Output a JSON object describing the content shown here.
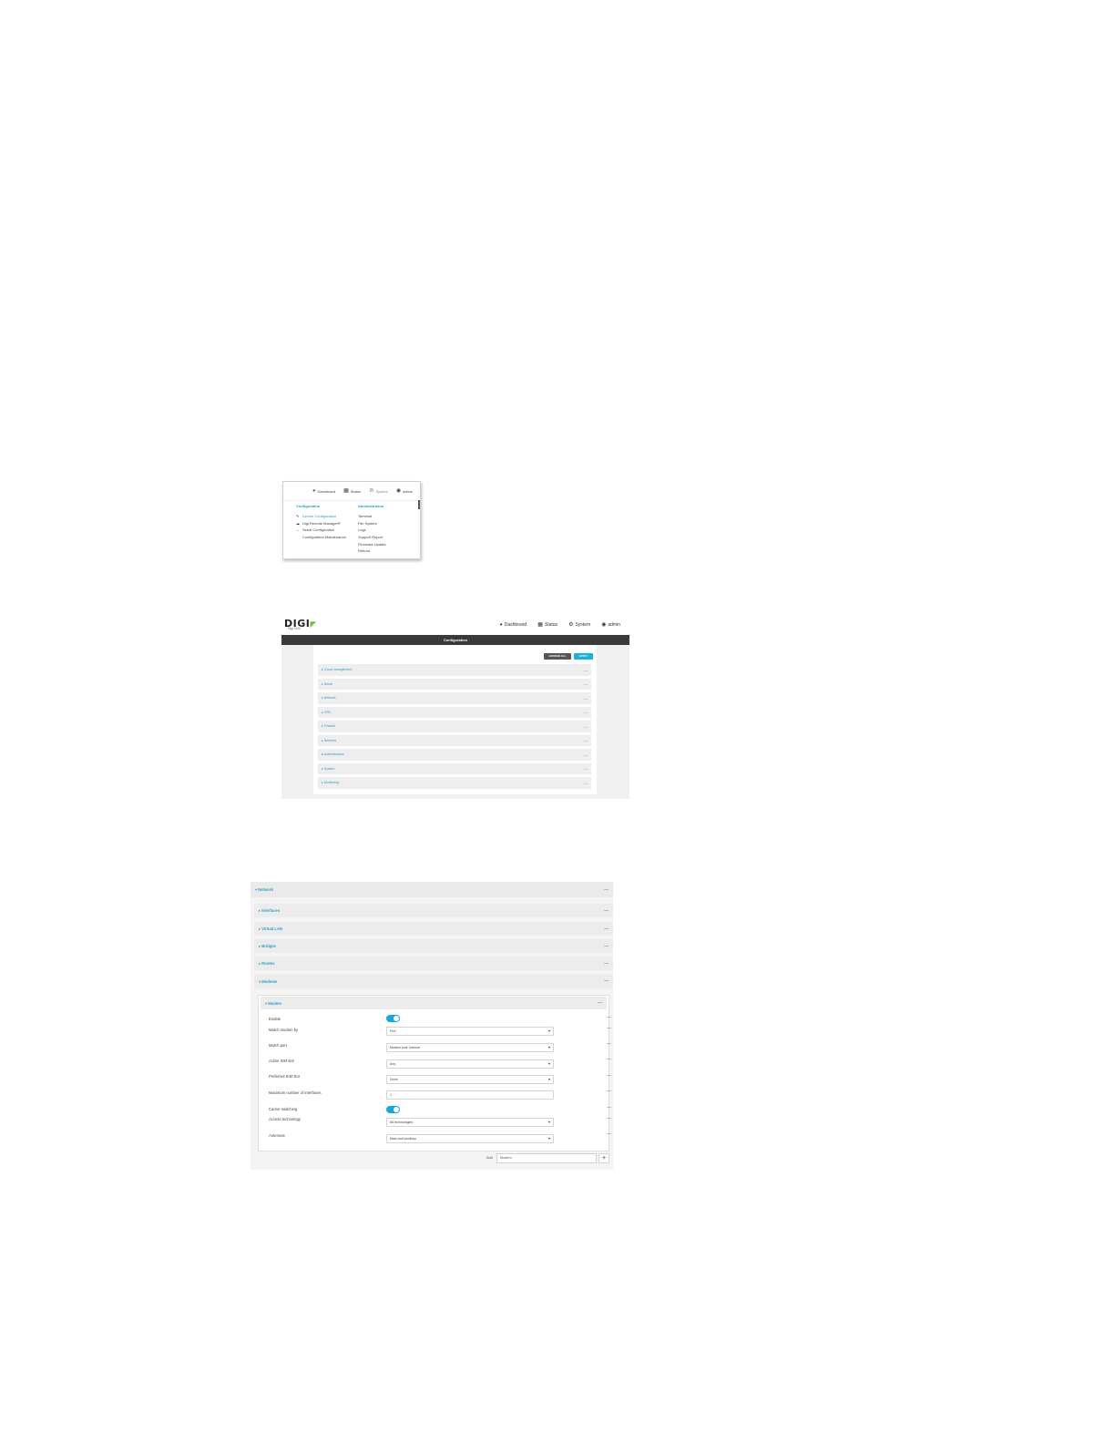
{
  "menu_shot": {
    "nav": [
      {
        "label": "Dashboard",
        "icon": "dashboard-icon"
      },
      {
        "label": "Status",
        "icon": "grid-icon"
      },
      {
        "label": "System",
        "icon": "gear-icon"
      },
      {
        "label": "admin",
        "icon": "user-icon"
      }
    ],
    "configuration": {
      "heading": "Configuration",
      "items": [
        "Device Configuration",
        "Digi Remote Manager®",
        "Serial Configuration",
        "Configuration Maintenance"
      ]
    },
    "administration": {
      "heading": "Administration",
      "items": [
        "Terminal",
        "File System",
        "Logs",
        "Support Report",
        "Firmware Update",
        "Reboot"
      ]
    }
  },
  "config_shot": {
    "logo": "DIGI",
    "logo_sub": "Digi IX20",
    "nav": [
      "Dashboard",
      "Status",
      "System",
      "admin"
    ],
    "title_bar": "Configuration",
    "buttons": {
      "expand_all": "EXPAND ALL",
      "apply": "APPLY"
    },
    "sections": [
      "Cloud management",
      "Serial",
      "Network",
      "VPN",
      "Firewall",
      "Services",
      "Authentication",
      "System",
      "Monitoring"
    ]
  },
  "network_shot": {
    "network": "Network",
    "subsections": [
      "Interfaces",
      "Virtual LAN",
      "Bridges",
      "Routes",
      "Modems"
    ],
    "modem": "Modem",
    "fields": {
      "enable": "Enable",
      "match_by": {
        "label": "Match modem by",
        "value": "Port"
      },
      "match_port": {
        "label": "Match port",
        "value": "Modem port: internal"
      },
      "active_sim": {
        "label": "Active SIM slot",
        "value": "Any"
      },
      "preferred_sim": {
        "label": "Preferred SIM slot",
        "value": "None"
      },
      "max_interfaces": {
        "label": "Maximum number of interfaces",
        "value": "1"
      },
      "carrier_switching": "Carrier switching",
      "access_tech": {
        "label": "Access technology",
        "value": "All technologies"
      },
      "antennas": {
        "label": "Antennas",
        "value": "Main and auxiliary"
      }
    },
    "add_label": "Add",
    "add_value": "Modem"
  }
}
